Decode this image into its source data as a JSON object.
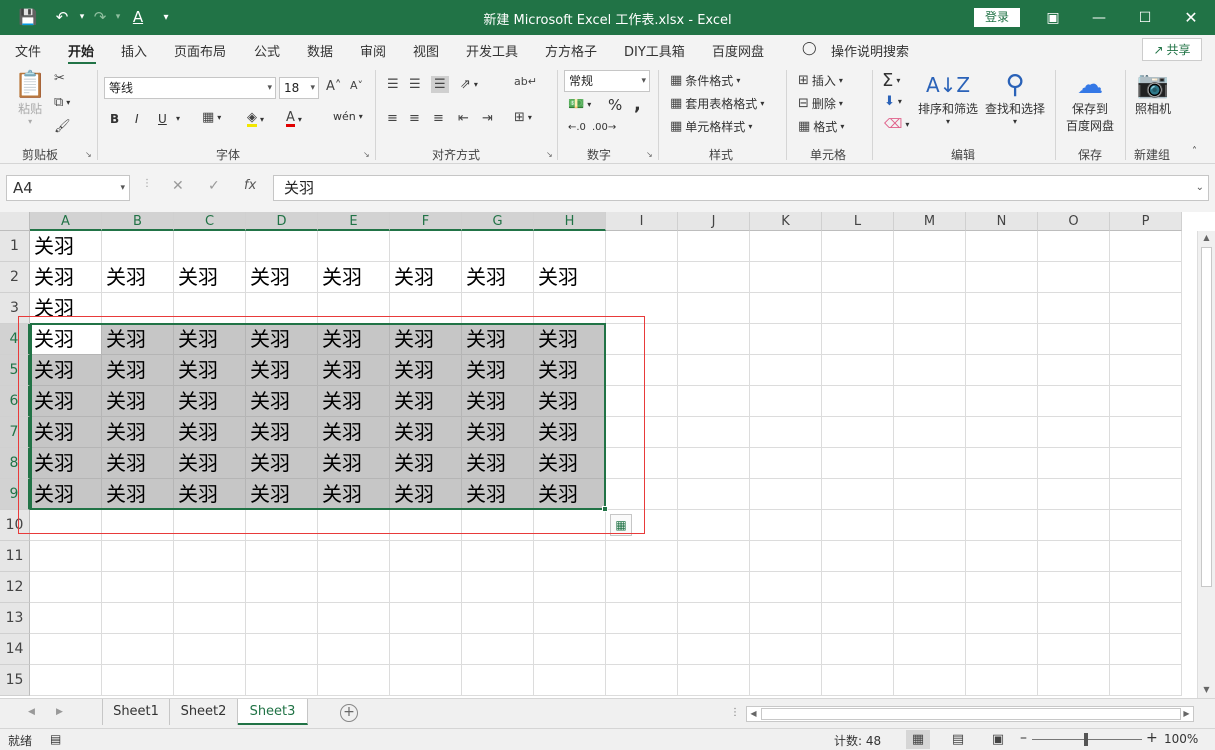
{
  "window": {
    "title": "新建 Microsoft Excel 工作表.xlsx  -  Excel",
    "login_label": "登录",
    "quick_access": [
      "save-icon",
      "undo-icon",
      "redo-icon",
      "font-color-icon",
      "customize-icon"
    ],
    "controls": [
      "ribbon-display-icon",
      "minimize-icon",
      "maximize-icon",
      "close-icon"
    ]
  },
  "tabs": {
    "items": [
      "文件",
      "开始",
      "插入",
      "页面布局",
      "公式",
      "数据",
      "审阅",
      "视图",
      "开发工具",
      "方方格子",
      "DIY工具箱",
      "百度网盘"
    ],
    "active": "开始",
    "tell_me": "操作说明搜索",
    "share": "共享"
  },
  "ribbon": {
    "clipboard": {
      "paste": "粘贴",
      "label": "剪贴板"
    },
    "font": {
      "name": "等线",
      "size": "18",
      "label": "字体",
      "bold": "B",
      "italic": "I",
      "underline": "U"
    },
    "alignment": {
      "label": "对齐方式"
    },
    "number": {
      "format": "常规",
      "label": "数字",
      "percent": "%",
      "comma": ","
    },
    "styles": {
      "conditional": "条件格式",
      "table": "套用表格格式",
      "cell": "单元格样式",
      "label": "样式"
    },
    "cells": {
      "insert": "插入",
      "delete": "删除",
      "format": "格式",
      "label": "单元格"
    },
    "editing": {
      "sort": "排序和筛选",
      "find": "查找和选择",
      "label": "编辑"
    },
    "save": {
      "save_to": "保存到",
      "save_to2": "百度网盘",
      "label": "保存"
    },
    "newgroup": {
      "camera": "照相机",
      "label": "新建组"
    }
  },
  "formula_bar": {
    "name_box": "A4",
    "formula": "关羽",
    "fx": "fx"
  },
  "grid": {
    "columns": [
      "A",
      "B",
      "C",
      "D",
      "E",
      "F",
      "G",
      "H",
      "I",
      "J",
      "K",
      "L",
      "M",
      "N",
      "O",
      "P"
    ],
    "rows": [
      "1",
      "2",
      "3",
      "4",
      "5",
      "6",
      "7",
      "8",
      "9",
      "10",
      "11",
      "12",
      "13",
      "14",
      "15"
    ],
    "cells": [
      [
        "关羽",
        "",
        "",
        "",
        "",
        "",
        "",
        ""
      ],
      [
        "关羽",
        "关羽",
        "关羽",
        "关羽",
        "关羽",
        "关羽",
        "关羽",
        "关羽"
      ],
      [
        "关羽",
        "",
        "",
        "",
        "",
        "",
        "",
        ""
      ],
      [
        "关羽",
        "关羽",
        "关羽",
        "关羽",
        "关羽",
        "关羽",
        "关羽",
        "关羽"
      ],
      [
        "关羽",
        "关羽",
        "关羽",
        "关羽",
        "关羽",
        "关羽",
        "关羽",
        "关羽"
      ],
      [
        "关羽",
        "关羽",
        "关羽",
        "关羽",
        "关羽",
        "关羽",
        "关羽",
        "关羽"
      ],
      [
        "关羽",
        "关羽",
        "关羽",
        "关羽",
        "关羽",
        "关羽",
        "关羽",
        "关羽"
      ],
      [
        "关羽",
        "关羽",
        "关羽",
        "关羽",
        "关羽",
        "关羽",
        "关羽",
        "关羽"
      ],
      [
        "关羽",
        "关羽",
        "关羽",
        "关羽",
        "关羽",
        "关羽",
        "关羽",
        "关羽"
      ]
    ],
    "selection": "A4:H9",
    "active_cell": "A4"
  },
  "sheets": {
    "tabs": [
      "Sheet1",
      "Sheet2",
      "Sheet3"
    ],
    "active": "Sheet3"
  },
  "status": {
    "ready": "就绪",
    "count": "计数: 48",
    "zoom": "100%"
  },
  "colors": {
    "accent": "#217346",
    "selection_fill": "#c6c6c6",
    "annotation": "#e83a3a"
  }
}
